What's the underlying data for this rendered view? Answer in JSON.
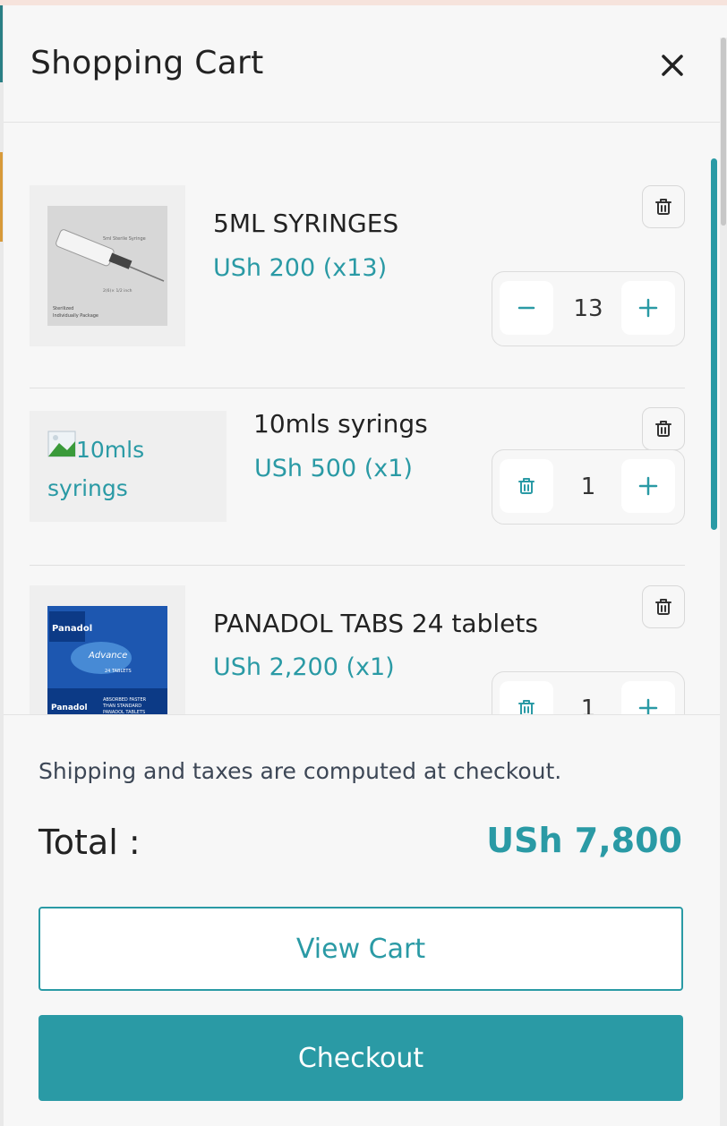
{
  "cart": {
    "title": "Shopping Cart",
    "items": [
      {
        "name": "5ML SYRINGES",
        "price": "USh 200 (x13)",
        "qty": "13",
        "image_caption_top": "5ml Sterile Syringe",
        "image_caption_mid": "2(6)× 1/2 inch",
        "image_caption_bottom1": "Sterilized",
        "image_caption_bottom2": "Individually Package"
      },
      {
        "name": "10mls syrings",
        "price": "USh 500 (x1)",
        "qty": "1",
        "image_alt": "10mls syrings"
      },
      {
        "name": "PANADOL TABS 24 tablets",
        "price": "USh 2,200 (x1)",
        "qty": "1",
        "image_brand": "Panadol",
        "image_sub": "Advance",
        "image_count": "24 TABLETS",
        "image_tag1": "ABSORBED FASTER",
        "image_tag2": "THAN STANDARD",
        "image_tag3": "PANADOL TABLETS"
      }
    ]
  },
  "footer": {
    "shipping_note": "Shipping and taxes are computed at checkout.",
    "total_label": "Total :",
    "total_value": "USh 7,800",
    "view_cart": "View Cart",
    "checkout": "Checkout"
  },
  "colors": {
    "accent": "#2a9aa5"
  },
  "icons": {
    "close": "close-icon",
    "trash": "trash-icon",
    "minus": "minus-icon",
    "plus": "plus-icon"
  }
}
